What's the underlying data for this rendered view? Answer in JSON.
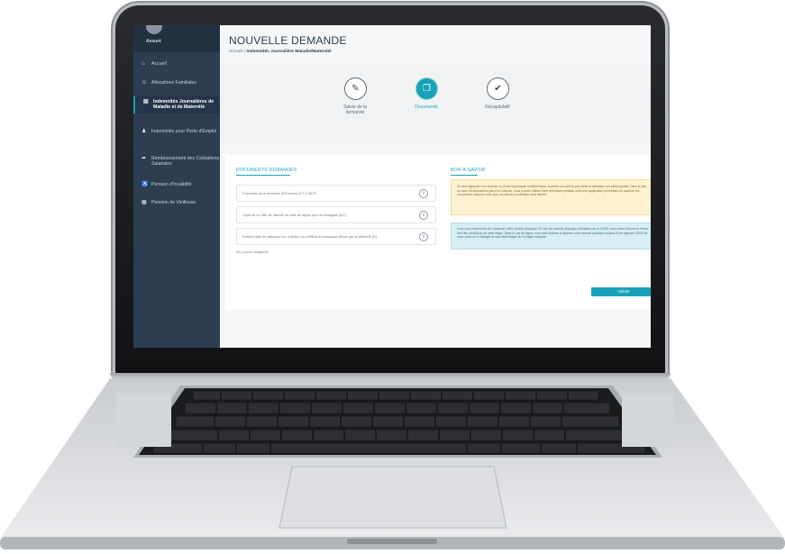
{
  "sidebar": {
    "user": "Assuré",
    "items": [
      {
        "icon": "home-icon",
        "glyph": "⌂",
        "label": "Accueil"
      },
      {
        "icon": "family-icon",
        "glyph": "☺",
        "label": "Allocations Familiales"
      },
      {
        "icon": "document-icon",
        "glyph": "▤",
        "label": "Indemnités Journalières de Maladie et de Maternité"
      },
      {
        "icon": "user-icon",
        "glyph": "♟",
        "label": "Indemnités pour Perte d'Emploi"
      },
      {
        "icon": "share-icon",
        "glyph": "➦",
        "label": "Remboursement des Cotisations Salariales"
      },
      {
        "icon": "accessibility-icon",
        "glyph": "♿",
        "label": "Pension d'Invalidité"
      },
      {
        "icon": "grid-icon",
        "glyph": "▦",
        "label": "Pension de Vieillesse"
      }
    ]
  },
  "header": {
    "title": "NOUVELLE DEMANDE",
    "breadcrumb_home": "Accueil",
    "breadcrumb_sep": "/",
    "breadcrumb_current": "Indemnités Journalière Maladie/Maternité"
  },
  "steps": [
    {
      "icon": "pencil-icon",
      "glyph": "✎",
      "label": "Saisie de la demande"
    },
    {
      "icon": "files-icon",
      "glyph": "❐",
      "label": "Documents"
    },
    {
      "icon": "check-icon",
      "glyph": "✔",
      "label": "Récapitulatif"
    }
  ],
  "documents": {
    "title": "DOCUMENTS DEMANDÉS",
    "rows": [
      "Formulaire de la demande (Réf.erence D.S.Y 56-P)",
      "Copie de la CNIE de l'assuré ou carte de séjour pour les étrangers (A.P)",
      "Extrait d'acte de naissance ou, à défaut, un certificat de naissance délivré par la Maternité (R)"
    ],
    "note": "(R) champ obligatoire"
  },
  "info": {
    "title": "BON À SAVOIR",
    "yellow_text": "Si vous disposez d'un scanner ou d'une imprimante multifonctions, scannez vos pièces par pièce et adressez vos pièces justifs. Dans le cas où vous ne disposeriez pas d'un scanner, vous pouvez utiliser votre téléphone portable avec une application permettant de scanner les documents. Assurez-vous que vos pièces numérisées sont lisibles.",
    "blue_text": "Vous vous remercions de conserver votre dossier physique. En cas de contrôle physique demandé par la CNSS vous serez informé en temps réel des conditions de cette étape. Dans le cas de figure vous vous invitons à déposer votre dossier physique auprès d'une agence CNSS de votre choix ou à l'intégrer le rayo télécharger du à l'étape suivante."
  },
  "actions": {
    "validate": "Valider"
  },
  "colors": {
    "accent": "#17a2b8",
    "sidebar": "#2c3e50"
  }
}
